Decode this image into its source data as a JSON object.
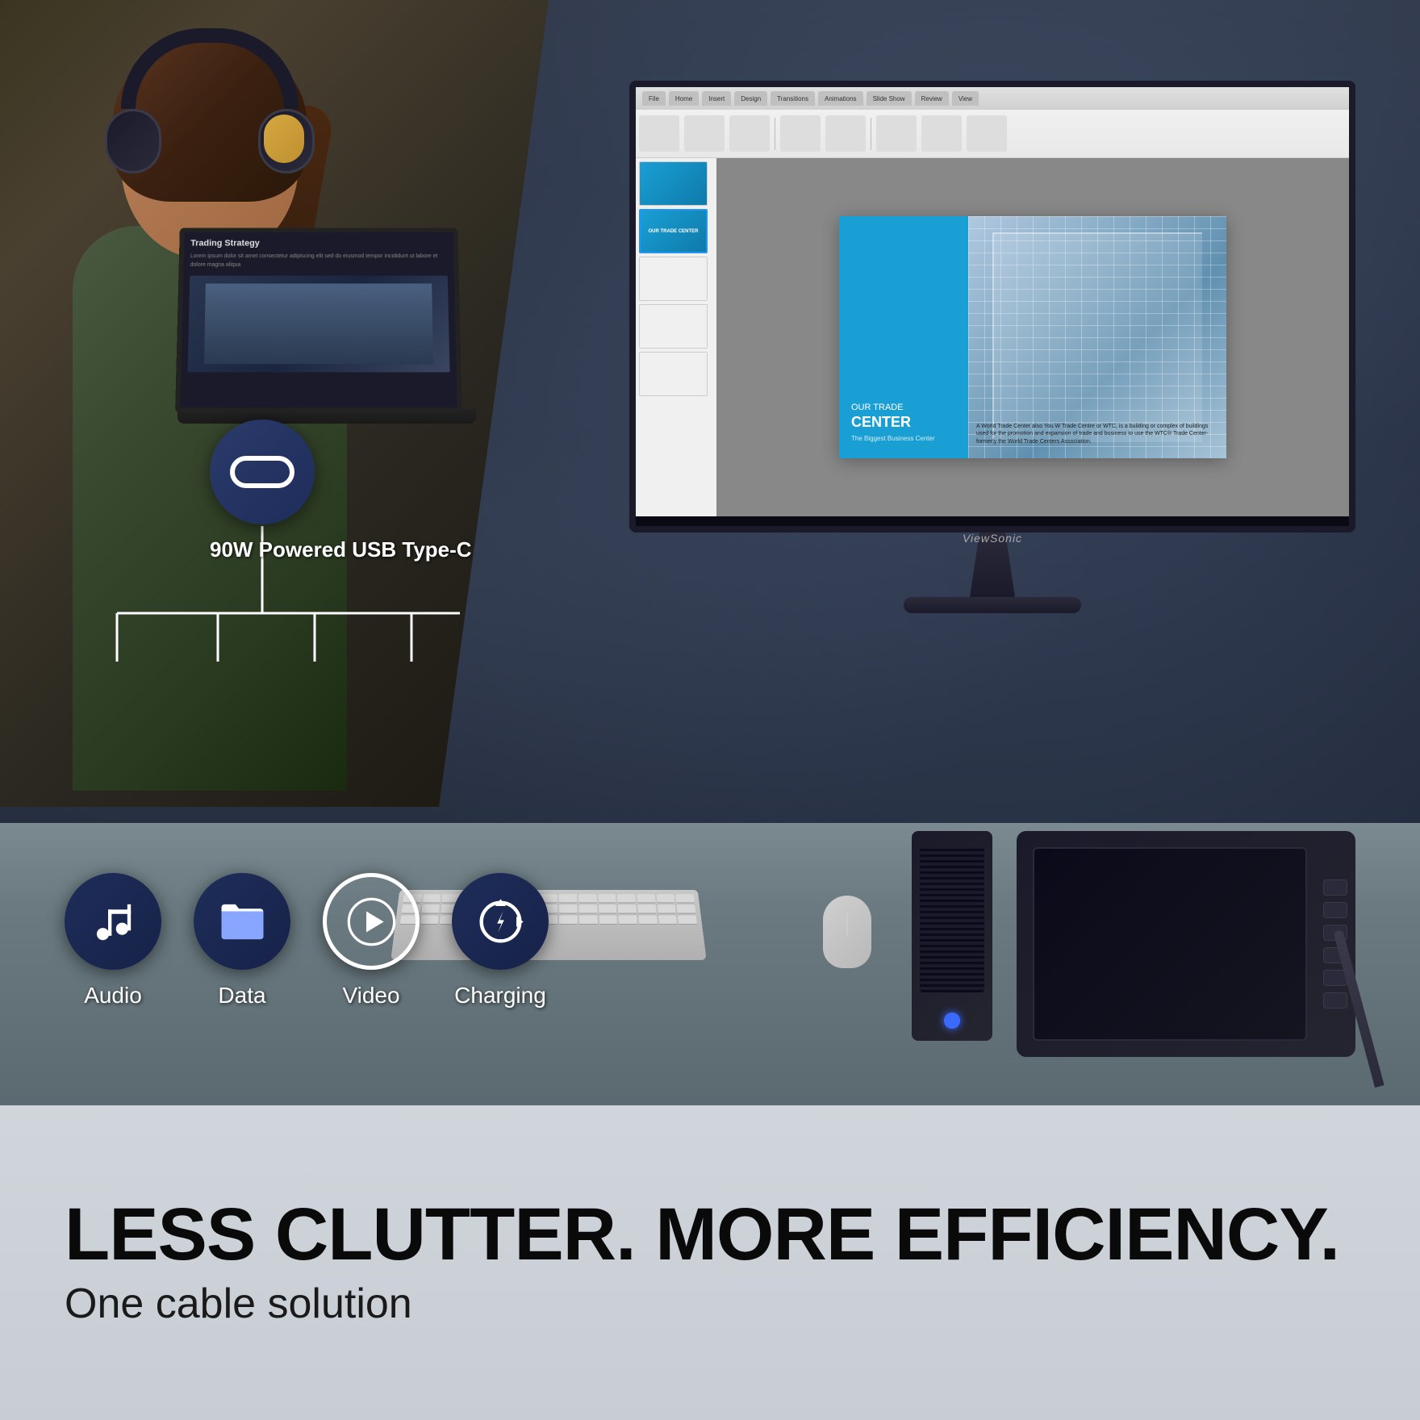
{
  "product": {
    "brand": "ViewSonic",
    "feature_badge": "90W Powered USB Type-C",
    "tagline_main": "LESS CLUTTER. MORE EFFICIENCY.",
    "tagline_sub": "One cable solution"
  },
  "features": [
    {
      "id": "audio",
      "label": "Audio",
      "icon": "music-icon"
    },
    {
      "id": "data",
      "label": "Data",
      "icon": "data-icon"
    },
    {
      "id": "video",
      "label": "Video",
      "icon": "video-icon"
    },
    {
      "id": "charging",
      "label": "Charging",
      "icon": "charging-icon"
    }
  ],
  "laptop_content": {
    "title": "Trading Strategy",
    "body_text": "Lorem ipsum dolor sit amet consectetur adipiscing elit sed do eiusmod tempor incididunt ut labore et dolore magna aliqua"
  },
  "slide_content": {
    "pre_title": "OUR TRADE",
    "main_title": "CENTER",
    "sub_title": "The Biggest Business Center",
    "body": "A World Trade Center also You W Trade Centre or WTC, is a building or complex of buildings used for the promotion and expansion of trade and business to use the WTC® Trade Center-formerly the World Trade Centers Association."
  },
  "colors": {
    "navy": "#1e2d5a",
    "accent_blue": "#1a9fd4",
    "dark_bg": "#0a0a15",
    "light_bg": "#c8cdd4",
    "text_dark": "#0a0a0a"
  }
}
